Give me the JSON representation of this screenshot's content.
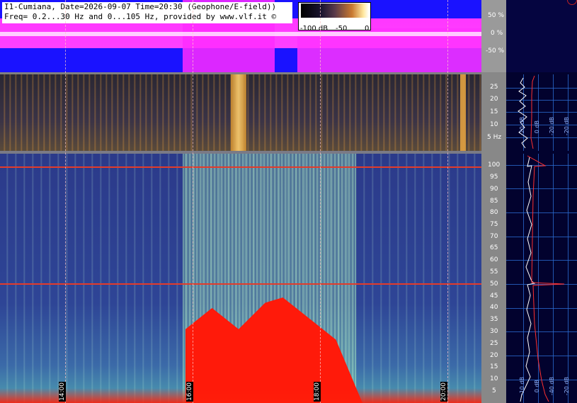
{
  "header": {
    "line1": "I1-Cumiana, Date=2026-09-07 Time=20:30 (Geophone/E-field))",
    "line2": "Freq= 0.2...30 Hz and 0...105 Hz, provided by www.vlf.it ©"
  },
  "colorbar": {
    "label_min": "-100 dB",
    "label_mid": "-50",
    "label_max": "0"
  },
  "waveform_axis": [
    "50 %",
    "0 %",
    "-50 %"
  ],
  "low_freq_axis": [
    "25",
    "20",
    "15",
    "10",
    "5 Hz"
  ],
  "high_freq_axis": [
    "100",
    "95",
    "90",
    "85",
    "80",
    "75",
    "70",
    "65",
    "60",
    "55",
    "50",
    "45",
    "40",
    "35",
    "30",
    "25",
    "20",
    "15",
    "10",
    "5"
  ],
  "time_labels": [
    "14:00",
    "16:00",
    "18:00",
    "20:00"
  ],
  "side_panel": {
    "top_labels": [
      "-20 dB",
      "0 dB",
      "-20 dB",
      "-40 dB",
      "-20 dB"
    ],
    "bottom_labels": [
      "-10 dB",
      "0 dB",
      "-10 dB",
      "-40 dB",
      "-20 dB"
    ]
  },
  "colors": {
    "waveform_bg": "#1a12ff",
    "waveform_signal": "#ff37ff",
    "spectrogram_bg": "#2b3a8a",
    "hum_line": "#e33b2a",
    "side_panel_bg": "#02022e"
  }
}
